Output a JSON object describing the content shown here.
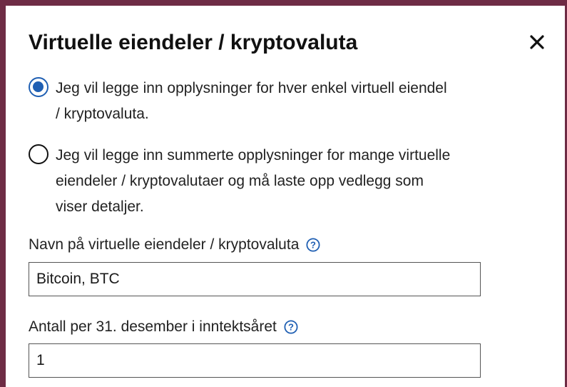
{
  "dialog": {
    "title": "Virtuelle eiendeler / kryptovaluta",
    "close_icon": "close-icon"
  },
  "options": [
    {
      "label": "Jeg vil legge inn opplysninger for hver enkel virtuell eiendel / kryptovaluta.",
      "selected": true
    },
    {
      "label": "Jeg vil legge inn summerte opplysninger for mange virtuelle eiendeler / kryptovalutaer og må laste opp vedlegg som viser detaljer.",
      "selected": false
    }
  ],
  "fields": {
    "name": {
      "label": "Navn på virtuelle eiendeler / kryptovaluta",
      "value": "Bitcoin, BTC",
      "help_icon": "help-icon"
    },
    "quantity": {
      "label": "Antall per 31. desember i inntektsåret",
      "value": "1",
      "help_icon": "help-icon"
    }
  },
  "colors": {
    "frame": "#6e2c45",
    "accent": "#1f5fb3",
    "text": "#222222"
  }
}
